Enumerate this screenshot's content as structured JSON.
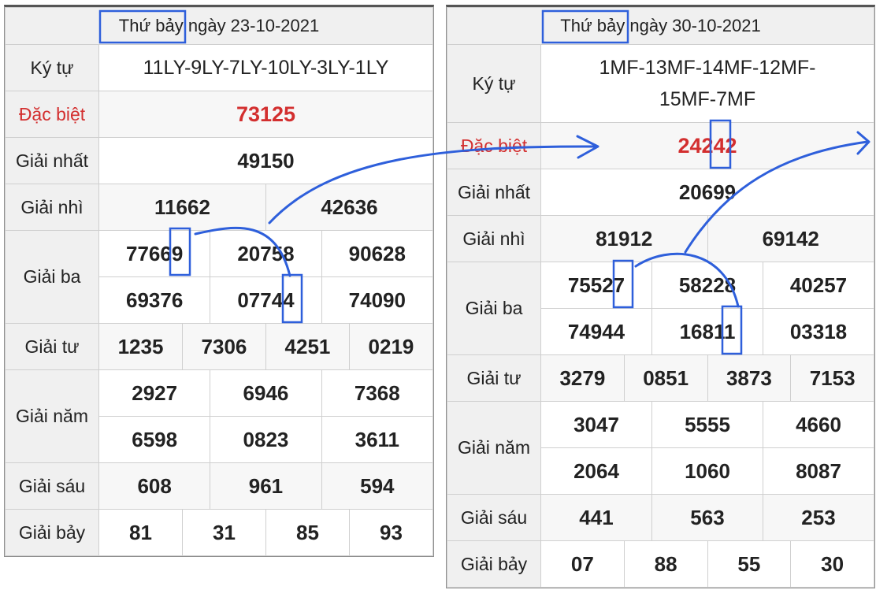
{
  "colors": {
    "special": "#d32f2f",
    "highlight": "#2e5fdb"
  },
  "draws": [
    {
      "header": "Thứ bảy ngày 23-10-2021",
      "labels": {
        "ky_tu": "Ký tự",
        "dac_biet": "Đặc biệt",
        "nhat": "Giải nhất",
        "nhi": "Giải nhì",
        "ba": "Giải ba",
        "tu": "Giải tư",
        "nam": "Giải năm",
        "sau": "Giải sáu",
        "bay": "Giải bảy"
      },
      "ky_tu": "11LY-9LY-7LY-10LY-3LY-1LY",
      "dac_biet": "73125",
      "nhat": "49150",
      "nhi": [
        "11662",
        "42636"
      ],
      "ba": [
        "77669",
        "20758",
        "90628",
        "69376",
        "07744",
        "74090"
      ],
      "tu": [
        "1235",
        "7306",
        "4251",
        "0219"
      ],
      "nam": [
        "2927",
        "6946",
        "7368",
        "6598",
        "0823",
        "3611"
      ],
      "sau": [
        "608",
        "961",
        "594"
      ],
      "bay": [
        "81",
        "31",
        "85",
        "93"
      ]
    },
    {
      "header": "Thứ bảy ngày 30-10-2021",
      "labels": {
        "ky_tu": "Ký tự",
        "dac_biet": "Đặc biệt",
        "nhat": "Giải nhất",
        "nhi": "Giải nhì",
        "ba": "Giải ba",
        "tu": "Giải tư",
        "nam": "Giải năm",
        "sau": "Giải sáu",
        "bay": "Giải bảy"
      },
      "ky_tu": "1MF-13MF-14MF-12MF-15MF-7MF",
      "dac_biet": "24242",
      "nhat": "20699",
      "nhi": [
        "81912",
        "69142"
      ],
      "ba": [
        "75527",
        "58228",
        "40257",
        "74944",
        "16811",
        "03318"
      ],
      "tu": [
        "3279",
        "0851",
        "3873",
        "7153"
      ],
      "nam": [
        "3047",
        "5555",
        "4660",
        "2064",
        "1060",
        "8087"
      ],
      "sau": [
        "441",
        "563",
        "253"
      ],
      "bay": [
        "07",
        "88",
        "55",
        "30"
      ]
    }
  ]
}
